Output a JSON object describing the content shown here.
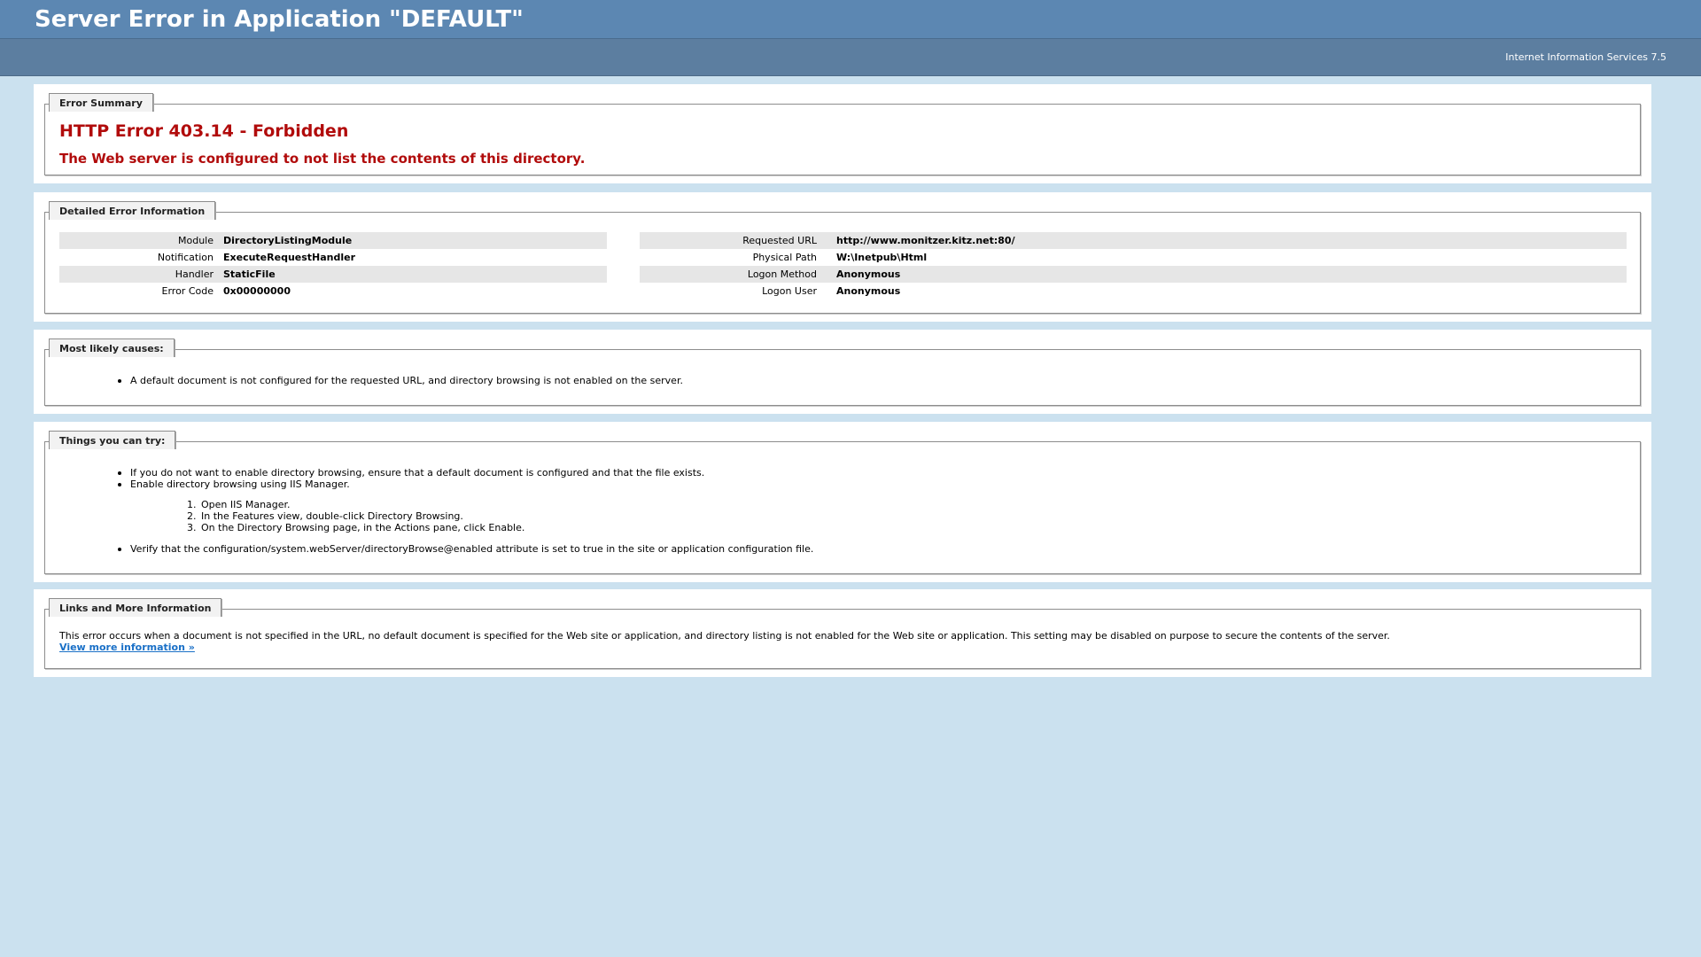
{
  "header": {
    "title": "Server Error in Application \"DEFAULT\"",
    "server": "Internet Information Services 7.5"
  },
  "summary": {
    "legend": "Error Summary",
    "title": "HTTP Error 403.14 - Forbidden",
    "subtitle": "The Web server is configured to not list the contents of this directory."
  },
  "details": {
    "legend": "Detailed Error Information",
    "left": [
      {
        "label": "Module",
        "value": "DirectoryListingModule"
      },
      {
        "label": "Notification",
        "value": "ExecuteRequestHandler"
      },
      {
        "label": "Handler",
        "value": "StaticFile"
      },
      {
        "label": "Error Code",
        "value": "0x00000000"
      }
    ],
    "right": [
      {
        "label": "Requested URL",
        "value": "http://www.monitzer.kitz.net:80/"
      },
      {
        "label": "Physical Path",
        "value": "W:\\Inetpub\\Html"
      },
      {
        "label": "Logon Method",
        "value": "Anonymous"
      },
      {
        "label": "Logon User",
        "value": "Anonymous"
      }
    ]
  },
  "causes": {
    "legend": "Most likely causes:",
    "items": [
      "A default document is not configured for the requested URL, and directory browsing is not enabled on the server."
    ]
  },
  "try": {
    "legend": "Things you can try:",
    "items": [
      "If you do not want to enable directory browsing, ensure that a default document is configured and that the file exists.",
      "Enable directory browsing using IIS Manager."
    ],
    "steps": [
      {
        "num": "1.",
        "text": "Open IIS Manager."
      },
      {
        "num": "2.",
        "text": "In the Features view, double-click Directory Browsing."
      },
      {
        "num": "3.",
        "text": "On the Directory Browsing page, in the Actions pane, click Enable."
      }
    ],
    "last_item": "Verify that the configuration/system.webServer/directoryBrowse@enabled attribute is set to true in the site or application configuration file."
  },
  "links": {
    "legend": "Links and More Information",
    "text": "This error occurs when a document is not specified in the URL, no default document is specified for the Web site or application, and directory listing is not enabled for the Web site or application. This setting may be disabled on purpose to secure the contents of the server.",
    "more": "View more information »"
  }
}
